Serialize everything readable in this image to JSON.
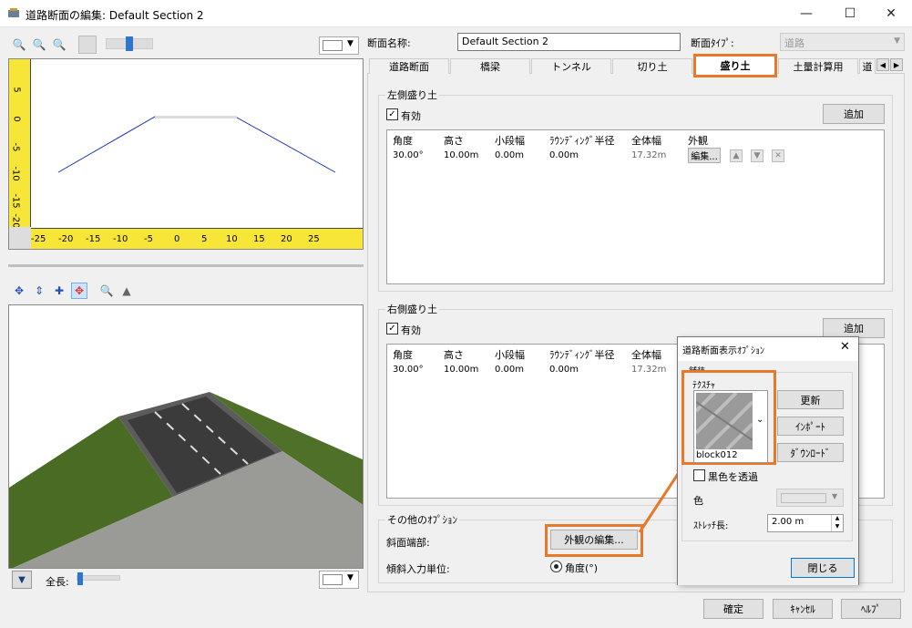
{
  "window": {
    "title": "道路断面の編集: Default Section 2",
    "minimize": "—",
    "maximize": "☐",
    "close": "✕"
  },
  "preview2d": {
    "y_ticks": [
      "5",
      "0",
      "-5",
      "-10",
      "-15",
      "-20"
    ],
    "x_ticks": [
      "-25",
      "-20",
      "-15",
      "-10",
      "-5",
      "0",
      "5",
      "10",
      "15",
      "20",
      "25"
    ],
    "dropdown_value": ""
  },
  "preview3d": {
    "length_label": "全長:",
    "dropdown_value": ""
  },
  "section": {
    "name_label": "断面名称:",
    "name_value": "Default Section 2",
    "type_label": "断面ﾀｲﾌﾟ:",
    "type_value": "道路"
  },
  "tabs": [
    "道路断面",
    "橋梁",
    "トンネル",
    "切り土",
    "盛り土",
    "土量計算用",
    "道"
  ],
  "left_group": {
    "label": "左側盛り土",
    "enabled_label": "有効",
    "add_label": "追加",
    "columns": [
      "角度",
      "高さ",
      "小段幅",
      "ﾗｳﾝﾃﾞｨﾝｸﾞ半径",
      "全体幅",
      "外観"
    ],
    "row": {
      "angle": "30.00°",
      "height": "10.00m",
      "berm": "0.00m",
      "radius": "0.00m",
      "width": "17.32m",
      "edit": "編集..."
    }
  },
  "right_group": {
    "label": "右側盛り土",
    "enabled_label": "有効",
    "add_label": "追加",
    "columns": [
      "角度",
      "高さ",
      "小段幅",
      "ﾗｳﾝﾃﾞｨﾝｸﾞ半径",
      "全体幅"
    ],
    "row": {
      "angle": "30.00°",
      "height": "10.00m",
      "berm": "0.00m",
      "radius": "0.00m",
      "width": "17.32m"
    }
  },
  "other_options": {
    "label": "その他のｵﾌﾟｼｮﾝ",
    "slope_end_label": "斜面端部:",
    "appearance_edit": "外観の編集...",
    "slope_unit_label": "傾斜入力単位:",
    "angle_option": "角度(°)"
  },
  "footer": {
    "ok": "確定",
    "cancel": "ｷｬﾝｾﾙ",
    "help": "ﾍﾙﾌﾟ"
  },
  "popup": {
    "title": "道路断面表示ｵﾌﾟｼｮﾝ",
    "partial_label": "舗装",
    "texture_label": "ﾃｸｽﾁｬ",
    "texture_name": "block012",
    "update": "更新",
    "import": "ｲﾝﾎﾟｰﾄ",
    "download": "ﾀﾞｳﾝﾛｰﾄﾞ",
    "transparent_label": "黒色を透過",
    "color_label": "色",
    "stretch_label": "ｽﾄﾚｯﾁ長:",
    "stretch_value": "2.00 m",
    "close": "閉じる"
  },
  "accent_color": "#e8782a"
}
